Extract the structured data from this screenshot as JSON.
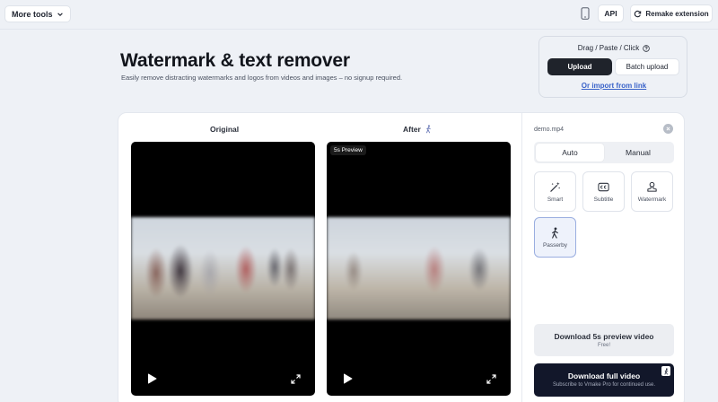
{
  "header": {
    "more_tools": "More tools",
    "api": "API",
    "remake_extension": "Remake extension"
  },
  "hero": {
    "title": "Watermark & text remover",
    "subtitle": "Easily remove distracting watermarks and logos from videos and images – no signup required."
  },
  "upload": {
    "drag_label": "Drag / Paste / Click",
    "upload_button": "Upload",
    "batch_button": "Batch upload",
    "import_link": "Or import from link"
  },
  "editor": {
    "original_label": "Original",
    "after_label": "After",
    "preview_badge": "5s Preview"
  },
  "sidebar": {
    "file_name": "demo.mp4",
    "modes": [
      "Auto",
      "Manual"
    ],
    "active_mode": "Auto",
    "tools": [
      {
        "label": "Smart",
        "icon": "magic-wand-icon"
      },
      {
        "label": "Subtitle",
        "icon": "subtitle-icon"
      },
      {
        "label": "Watermark",
        "icon": "stamp-icon"
      },
      {
        "label": "Passerby",
        "icon": "walking-person-icon"
      }
    ],
    "selected_tool": "Passerby",
    "preview_download": {
      "title": "Download 5s preview video",
      "subtitle": "Free!"
    },
    "full_download": {
      "title": "Download full video",
      "subtitle": "Subscribe to Vmake Pro for continued use."
    }
  },
  "colors": {
    "primary_dark": "#1f232b",
    "link": "#3a63c9",
    "full_download_bg": "#12172a",
    "selected_tool_border": "#9aaee0"
  }
}
